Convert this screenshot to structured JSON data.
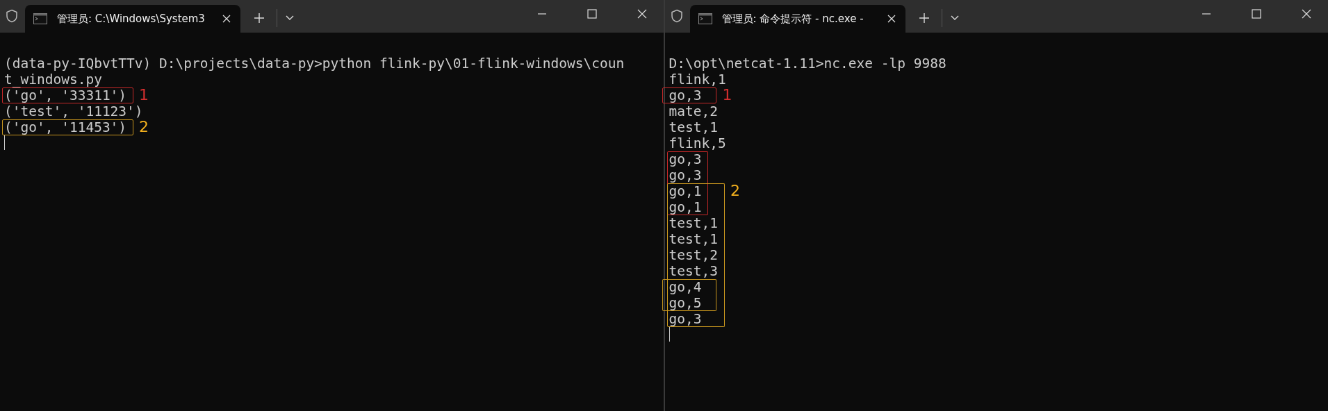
{
  "windows": [
    {
      "tab": {
        "title": "管理员: C:\\Windows\\System3",
        "selected": true
      },
      "cursor_visible": true,
      "lines": [
        {
          "text": "(data-py-IQbvtTTv) D:\\projects\\data-py>python flink-py\\01-flink-windows\\coun"
        },
        {
          "text": "t_windows.py"
        },
        {
          "text": "('go', '33311')",
          "boxes": [
            {
              "color": "#c62828",
              "kind": "narrow"
            }
          ],
          "label": {
            "text": "1",
            "color": "#d32f2f"
          }
        },
        {
          "text": "('test', '11123')"
        },
        {
          "text": "('go', '11453')",
          "boxes": [
            {
              "color": "#c8961e",
              "kind": "narrow"
            }
          ],
          "label": {
            "text": "2",
            "color": "#f2b01e"
          }
        }
      ]
    },
    {
      "tab": {
        "title": "管理员: 命令提示符 - nc.exe  -",
        "selected": true
      },
      "cursor_visible": true,
      "lines": [
        {
          "text": "D:\\opt\\netcat-1.11>nc.exe -lp 9988"
        },
        {
          "text": "flink,1"
        },
        {
          "text": "go,3",
          "boxes": [
            {
              "color": "#c62828",
              "kind": "wide"
            }
          ],
          "label": {
            "text": "1",
            "color": "#d32f2f"
          }
        },
        {
          "text": "mate,2"
        },
        {
          "text": "test,1"
        },
        {
          "text": "flink,5"
        },
        {
          "text": "go,3",
          "boxes": [
            {
              "color": "#c62828",
              "kind": "narrow"
            }
          ]
        },
        {
          "text": "go,3",
          "boxes": [
            {
              "color": "#c62828",
              "kind": "narrow"
            }
          ]
        },
        {
          "text": "go,1",
          "boxes": [
            {
              "color": "#c62828",
              "kind": "narrow"
            },
            {
              "color": "#c8961e",
              "kind": "narrow"
            }
          ],
          "label": {
            "text": "2",
            "color": "#f2b01e"
          }
        },
        {
          "text": "go,1",
          "boxes": [
            {
              "color": "#c62828",
              "kind": "narrow"
            },
            {
              "color": "#c8961e",
              "kind": "narrow"
            }
          ]
        },
        {
          "text": "test,1",
          "boxes": [
            {
              "color": "#c8961e",
              "kind": "narrow"
            }
          ]
        },
        {
          "text": "test,1",
          "boxes": [
            {
              "color": "#c8961e",
              "kind": "narrow"
            }
          ]
        },
        {
          "text": "test,2",
          "boxes": [
            {
              "color": "#c8961e",
              "kind": "narrow"
            }
          ]
        },
        {
          "text": "test,3",
          "boxes": [
            {
              "color": "#c8961e",
              "kind": "narrow"
            }
          ]
        },
        {
          "text": "go,4",
          "boxes": [
            {
              "color": "#c8961e",
              "kind": "narrow"
            },
            {
              "color": "#c8961e",
              "kind": "wide"
            }
          ]
        },
        {
          "text": "go,5",
          "boxes": [
            {
              "color": "#c8961e",
              "kind": "narrow"
            },
            {
              "color": "#c8961e",
              "kind": "wide"
            }
          ]
        },
        {
          "text": "go,3",
          "boxes": [
            {
              "color": "#c8961e",
              "kind": "narrow"
            }
          ]
        }
      ]
    }
  ]
}
